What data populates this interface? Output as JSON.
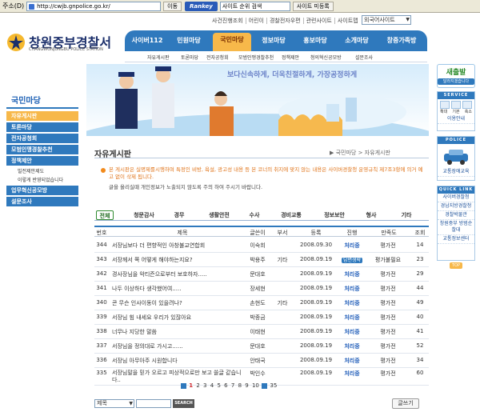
{
  "browser": {
    "address_label": "주소(D)",
    "url": "http://cwjb.gnpolice.go.kr/",
    "go_label": "이동",
    "rankey": "Rankey",
    "rank_search": "사이트 순위 검색",
    "site_reg": "사이트 미등록"
  },
  "header": {
    "top_links": [
      "사건진행조회",
      "어린이",
      "경찰전자우편",
      "관련사이트",
      "사이트맵"
    ],
    "foreign_site": "외국어사이트",
    "logo_title": "창원중부경찰서",
    "logo_sub": "CHANGWONJUNGBU POLICE STATION",
    "gnb": [
      "사이버112",
      "민원마당",
      "국민마당",
      "정보마당",
      "홍보마당",
      "소개마당",
      "창중가족방"
    ],
    "subnav": [
      "자유게시판",
      "토론마당",
      "전자공청회",
      "모범인맹경찰추천",
      "정책제안",
      "청의혁신공모방",
      "설문조사"
    ],
    "slogan": "보다신속하게, 더욱친절하게, 가장공정하게"
  },
  "sidebar": {
    "title": "국민마당",
    "items": [
      {
        "label": "자유게시판",
        "active": true
      },
      {
        "label": "토론마당"
      },
      {
        "label": "전자공청회"
      },
      {
        "label": "모범인맹경찰추천"
      },
      {
        "label": "정책제안"
      }
    ],
    "subitems": [
      "빌전제안제도",
      "이렇게 반영되었습니다"
    ],
    "items2": [
      "업무혁신공모방",
      "설문조사"
    ]
  },
  "quick": {
    "new_title": "새출발",
    "new_sub": "달라지겠습니다",
    "service_head": "SERVICE",
    "service_caps": [
      "확대",
      "기본",
      "축소"
    ],
    "service_link": "이용안내",
    "police_head": "POLICE",
    "police_link": "교통장애교육",
    "quick_head": "QUICK LINK",
    "quick_links": [
      "사이버경찰청",
      "경남지방경찰청",
      "경찰박물관",
      "창원중부 방범순찰대",
      "교통정보센터"
    ],
    "top": "TOP"
  },
  "board": {
    "title": "자유게시판",
    "breadcrumb": "▶ 국민마당 > 자유게시판",
    "notice1": "본 게시판은 실명제를시행하며 특정인 비방, 욕설, 광고성 내용 등 본 코너의 취지에 맞지 않는 내용은 사이버경찰청 운영규칙 제7조3항에 의거 예고 없이 삭제 됩니다.",
    "notice2": "글을 올리실때 개인정보가 노출되지 않도록 주의 하여 주시기 바랍니다.",
    "tabs": [
      "전체",
      "청문감사",
      "경무",
      "생활안전",
      "수사",
      "경비교통",
      "정보보안",
      "형사",
      "기타"
    ],
    "columns": [
      "번호",
      "제목",
      "글쓴이",
      "부서",
      "등록",
      "진행",
      "만족도",
      "조회"
    ],
    "rows": [
      {
        "no": "344",
        "title": "서장님보다 더 편향적인 아창불교연합회",
        "author": "이숙희",
        "dept": "",
        "date": "2008.09.30",
        "status": "처리중",
        "sat": "평가전",
        "views": "14"
      },
      {
        "no": "343",
        "title": "서장께서 쪽 어떻게 해야하는지요?",
        "author": "박용주",
        "dept": "기타",
        "date": "2008.09.19",
        "status": "답변생략",
        "sat": "평가불필요",
        "views": "23"
      },
      {
        "no": "342",
        "title": "경사장님을 악티즌으로부터 보호하자.....",
        "author": "문대호",
        "dept": "",
        "date": "2008.09.19",
        "status": "처리중",
        "sat": "평가전",
        "views": "29"
      },
      {
        "no": "341",
        "title": "나두 이상하다 생각했어여.....",
        "author": "장세현",
        "dept": "",
        "date": "2008.09.19",
        "status": "처리중",
        "sat": "평가전",
        "views": "44"
      },
      {
        "no": "340",
        "title": "콘 무슨 인사이동이 있을려나?",
        "author": "손현도",
        "dept": "기타",
        "date": "2008.09.19",
        "status": "처리중",
        "sat": "평가전",
        "views": "49"
      },
      {
        "no": "339",
        "title": "서장님 힘 내세요 우리가 있잖아요",
        "author": "박종금",
        "dept": "",
        "date": "2008.09.19",
        "status": "처리중",
        "sat": "평가전",
        "views": "40"
      },
      {
        "no": "338",
        "title": "너무나 지당한 말씀",
        "author": "이태현",
        "dept": "",
        "date": "2008.09.19",
        "status": "처리중",
        "sat": "평가전",
        "views": "41"
      },
      {
        "no": "337",
        "title": "서장님을 정의대로 가시고......",
        "author": "문대호",
        "dept": "",
        "date": "2008.09.19",
        "status": "처리중",
        "sat": "평가전",
        "views": "52"
      },
      {
        "no": "336",
        "title": "서장님 아무아주 시원합니다",
        "author": "안태국",
        "dept": "",
        "date": "2008.09.19",
        "status": "처리중",
        "sat": "평가전",
        "views": "34"
      },
      {
        "no": "335",
        "title": "서장님말을 믿가 오르고 피상적으로만 보고 쓸글 같습니다..",
        "author": "박인수",
        "dept": "",
        "date": "2008.09.19",
        "status": "처리중",
        "sat": "평가전",
        "views": "60"
      }
    ],
    "pages": [
      "1",
      "2",
      "3",
      "4",
      "5",
      "6",
      "7",
      "8",
      "9",
      "10"
    ],
    "last_page": "35",
    "search_field": "제목",
    "search_btn": "SEARCH",
    "write_btn": "글쓰기"
  }
}
